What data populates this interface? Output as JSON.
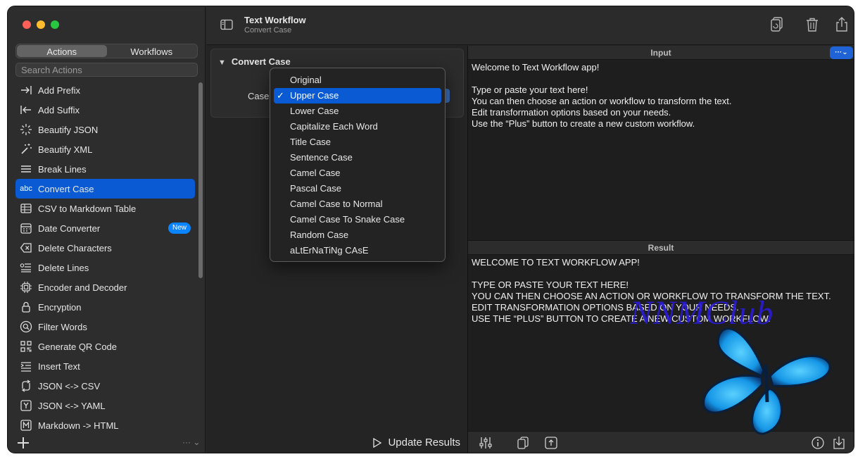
{
  "sidebar": {
    "tabs": [
      "Actions",
      "Workflows"
    ],
    "active_tab": "Actions",
    "search_placeholder": "Search Actions",
    "items": [
      {
        "label": "Add Prefix",
        "icon": "arrow-right-to-bar-icon"
      },
      {
        "label": "Add Suffix",
        "icon": "arrow-left-to-bar-icon"
      },
      {
        "label": "Beautify JSON",
        "icon": "sparkle-icon"
      },
      {
        "label": "Beautify XML",
        "icon": "magic-wand-icon"
      },
      {
        "label": "Break Lines",
        "icon": "lines-icon"
      },
      {
        "label": "Convert Case",
        "icon": "abc-icon",
        "icon_text": "abc",
        "selected": true
      },
      {
        "label": "CSV to Markdown Table",
        "icon": "table-icon"
      },
      {
        "label": "Date Converter",
        "icon": "calendar-icon",
        "badge": "New"
      },
      {
        "label": "Delete Characters",
        "icon": "delete-left-icon"
      },
      {
        "label": "Delete Lines",
        "icon": "delete-lines-icon"
      },
      {
        "label": "Encoder and Decoder",
        "icon": "cpu-icon"
      },
      {
        "label": "Encryption",
        "icon": "lock-icon"
      },
      {
        "label": "Filter Words",
        "icon": "magnifier-icon"
      },
      {
        "label": "Generate QR Code",
        "icon": "qr-code-icon"
      },
      {
        "label": "Insert Text",
        "icon": "insert-text-icon"
      },
      {
        "label": "JSON <-> CSV",
        "icon": "convert-arrows-icon"
      },
      {
        "label": "JSON <-> YAML",
        "icon": "y-box-icon"
      },
      {
        "label": "Markdown -> HTML",
        "icon": "m-box-icon"
      }
    ],
    "more": "··· ⌄"
  },
  "toolbar": {
    "title": "Text Workflow",
    "subtitle": "Convert Case"
  },
  "config": {
    "section_title": "Convert Case",
    "case_label": "Case:",
    "update_label": "Update Results"
  },
  "dropdown": {
    "options": [
      "Original",
      "Upper Case",
      "Lower Case",
      "Capitalize Each Word",
      "Title Case",
      "Sentence Case",
      "Camel Case",
      "Pascal Case",
      "Camel Case to Normal",
      "Camel Case To Snake Case",
      "Random Case",
      "aLtErNaTiNg CAsE"
    ],
    "selected": "Upper Case",
    "check_mark": "✓"
  },
  "input": {
    "title": "Input",
    "menu_button": "···",
    "text": "Welcome to Text Workflow app!\n\nType or paste your text here!\nYou can then choose an action or workflow to transform the text.\nEdit transformation options based on your needs.\nUse the “Plus” button to create a new custom workflow."
  },
  "result": {
    "title": "Result",
    "text": "WELCOME TO TEXT WORKFLOW APP!\n\nTYPE OR PASTE YOUR TEXT HERE!\nYOU CAN THEN CHOOSE AN ACTION OR WORKFLOW TO TRANSFORM THE TEXT.\nEDIT TRANSFORMATION OPTIONS BASED ON YOUR NEEDS.\nUSE THE “PLUS” BUTTON TO CREATE A NEW CUSTOM WORKFLOW."
  },
  "watermark": "NNMClub",
  "colors": {
    "accent": "#0a5bd3",
    "badge": "#0a84ff",
    "window_bg": "#242424",
    "sidebar_bg": "#2d2d2d"
  }
}
